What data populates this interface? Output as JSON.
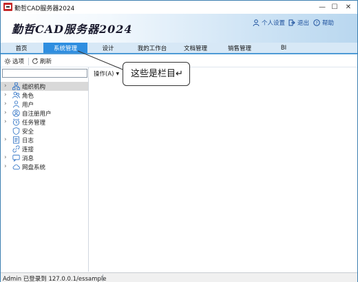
{
  "window": {
    "title": "勤哲CAD服务器2024",
    "minimize": "—",
    "maximize": "☐",
    "close": "✕"
  },
  "banner": {
    "title": "勤哲CAD服务器2024",
    "personal_settings": "个人设置",
    "logout": "退出",
    "help": "帮助"
  },
  "tabs": [
    {
      "label": "首页",
      "active": false
    },
    {
      "label": "系统管理",
      "active": true
    },
    {
      "label": "设计",
      "active": false
    },
    {
      "label": "我的工作台",
      "active": false
    },
    {
      "label": "文档管理",
      "active": false
    },
    {
      "label": "销售管理",
      "active": false
    },
    {
      "label": "BI",
      "active": false
    }
  ],
  "toolbar": {
    "options": "选项",
    "refresh": "刷新"
  },
  "search": {
    "value": "",
    "placeholder": ""
  },
  "tree": [
    {
      "label": "组织机构",
      "expandable": true,
      "selected": true,
      "icon": "org-icon"
    },
    {
      "label": "角色",
      "expandable": true,
      "selected": false,
      "icon": "roles-icon"
    },
    {
      "label": "用户",
      "expandable": true,
      "selected": false,
      "icon": "user-icon"
    },
    {
      "label": "自注册用户",
      "expandable": true,
      "selected": false,
      "icon": "self-register-icon"
    },
    {
      "label": "任务管理",
      "expandable": true,
      "selected": false,
      "icon": "task-icon"
    },
    {
      "label": "安全",
      "expandable": false,
      "selected": false,
      "icon": "shield-icon"
    },
    {
      "label": "日志",
      "expandable": true,
      "selected": false,
      "icon": "log-icon"
    },
    {
      "label": "连接",
      "expandable": false,
      "selected": false,
      "icon": "link-icon"
    },
    {
      "label": "消息",
      "expandable": true,
      "selected": false,
      "icon": "message-icon"
    },
    {
      "label": "网盘系统",
      "expandable": true,
      "selected": false,
      "icon": "cloud-disk-icon"
    }
  ],
  "right": {
    "operation_menu": "操作(A)"
  },
  "callout": {
    "text": "这些是栏目↵"
  },
  "status": {
    "text": "Admin 已登录到 127.0.0.1/essample"
  },
  "colors": {
    "accent": "#2f8ee0",
    "tab_bar": "#d7e8f6",
    "banner_link": "#1b4f9c"
  }
}
